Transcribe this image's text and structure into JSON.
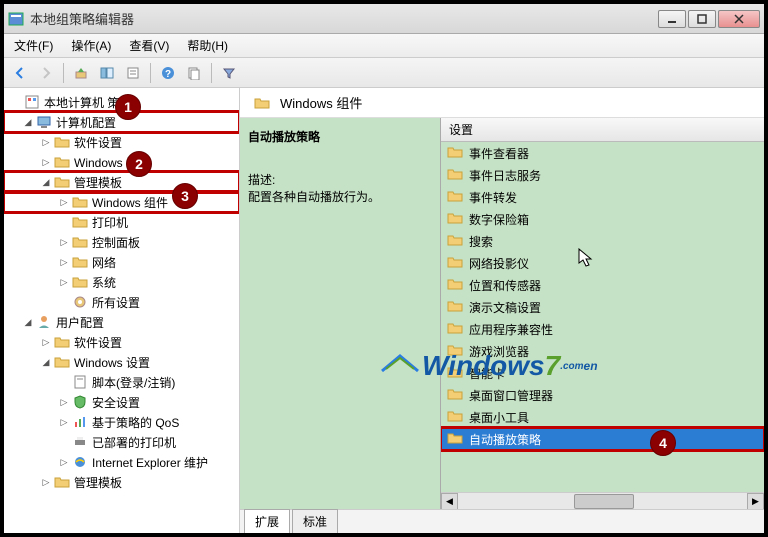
{
  "window": {
    "title": "本地组策略编辑器"
  },
  "menubar": [
    "文件(F)",
    "操作(A)",
    "查看(V)",
    "帮助(H)"
  ],
  "tree": {
    "root": "本地计算机 策略",
    "computer_config": "计算机配置",
    "software_settings": "软件设置",
    "windows_settings": "Windows 设置",
    "admin_templates": "管理模板",
    "windows_components": "Windows 组件",
    "printers": "打印机",
    "control_panel": "控制面板",
    "network": "网络",
    "system": "系统",
    "all_settings": "所有设置",
    "user_config": "用户配置",
    "u_software_settings": "软件设置",
    "u_windows_settings": "Windows 设置",
    "u_scripts": "脚本(登录/注销)",
    "u_security": "安全设置",
    "u_qos": "基于策略的 QoS",
    "u_printers": "已部署的打印机",
    "u_ie": "Internet Explorer 维护",
    "u_admin_templates": "管理模板"
  },
  "right": {
    "breadcrumb": "Windows 组件",
    "policy_title": "自动播放策略",
    "desc_label": "描述:",
    "desc_text": "配置各种自动播放行为。",
    "column_header": "设置",
    "items": [
      "事件查看器",
      "事件日志服务",
      "事件转发",
      "数字保险箱",
      "搜索",
      "网络投影仪",
      "位置和传感器",
      "演示文稿设置",
      "应用程序兼容性",
      "游戏浏览器",
      "智能卡",
      "桌面窗口管理器",
      "桌面小工具",
      "自动播放策略"
    ],
    "tabs": [
      "扩展",
      "标准"
    ]
  },
  "badges": {
    "b1": "1",
    "b2": "2",
    "b3": "3",
    "b4": "4"
  }
}
